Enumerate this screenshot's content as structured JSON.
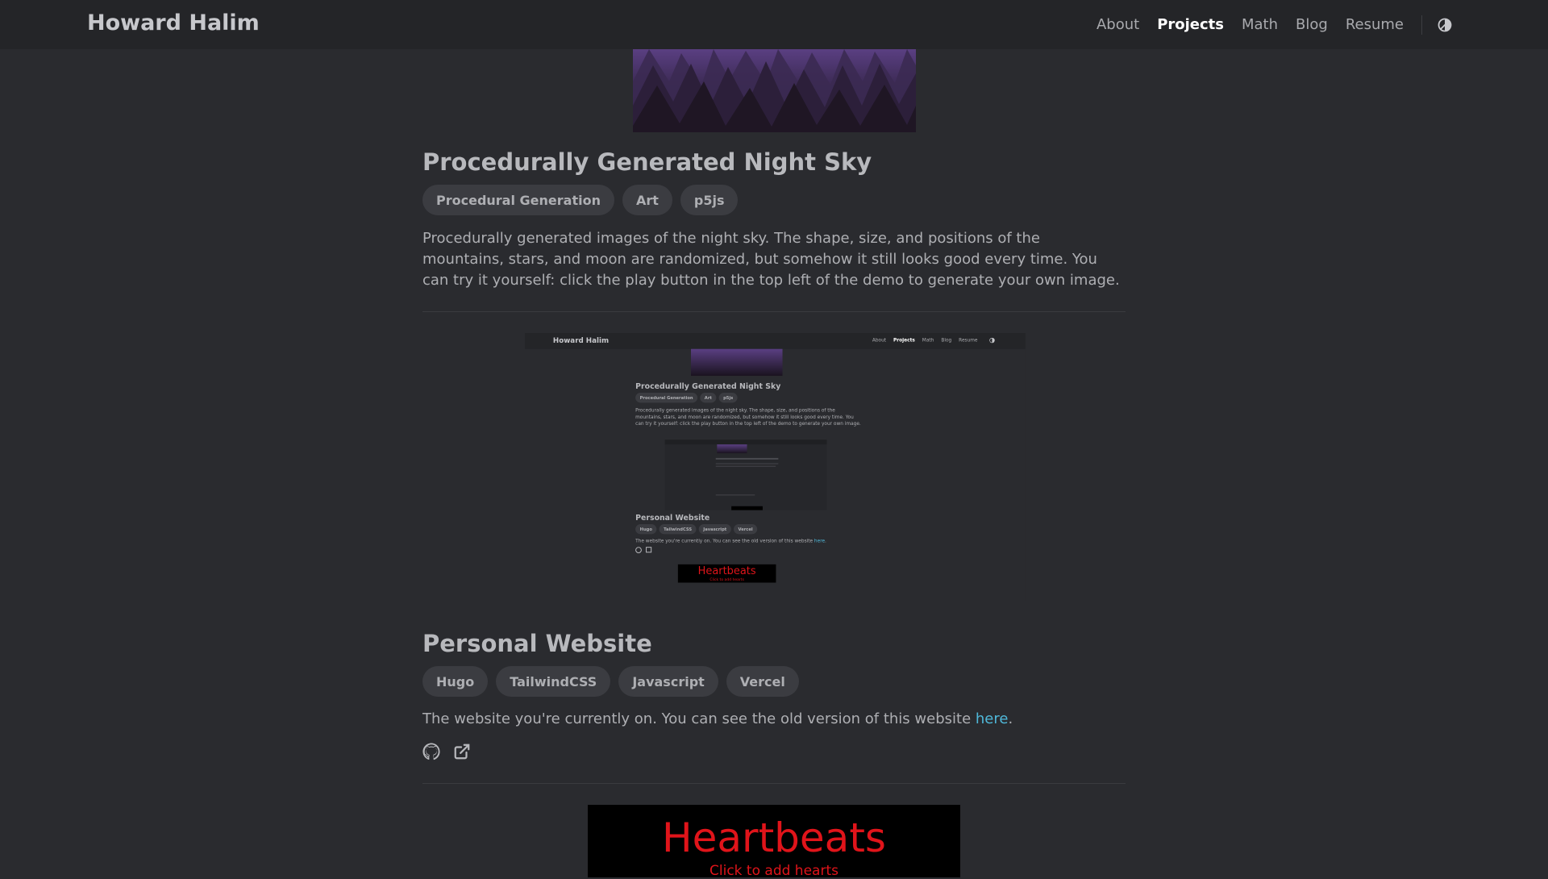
{
  "nav": {
    "brand": "Howard Halim",
    "links": [
      "About",
      "Projects",
      "Math",
      "Blog",
      "Resume"
    ],
    "active": "Projects",
    "theme_icon": "half-circle-icon"
  },
  "project1": {
    "title": "Procedurally Generated Night Sky",
    "tags": [
      "Procedural Generation",
      "Art",
      "p5js"
    ],
    "description": "Procedurally generated images of the night sky. The shape, size, and positions of the mountains, stars, and moon are randomized, but somehow it still looks good every time. You can try it yourself: click the play button in the top left of the demo to generate your own image."
  },
  "project2": {
    "title": "Personal Website",
    "tags": [
      "Hugo",
      "TailwindCSS",
      "Javascript",
      "Vercel"
    ],
    "description_prefix": "The website you're currently on. You can see the old version of this website ",
    "link_text": "here",
    "description_suffix": ".",
    "icons": [
      "github-icon",
      "external-link-icon"
    ]
  },
  "project3": {
    "title": "Heartbeats",
    "subtitle": "Click to add hearts"
  },
  "colors": {
    "background": "#2a2b2f",
    "navbar": "#242528",
    "tag_bg": "#3b3c41",
    "link": "#4fb8d9",
    "heart_red": "#e0141a"
  }
}
